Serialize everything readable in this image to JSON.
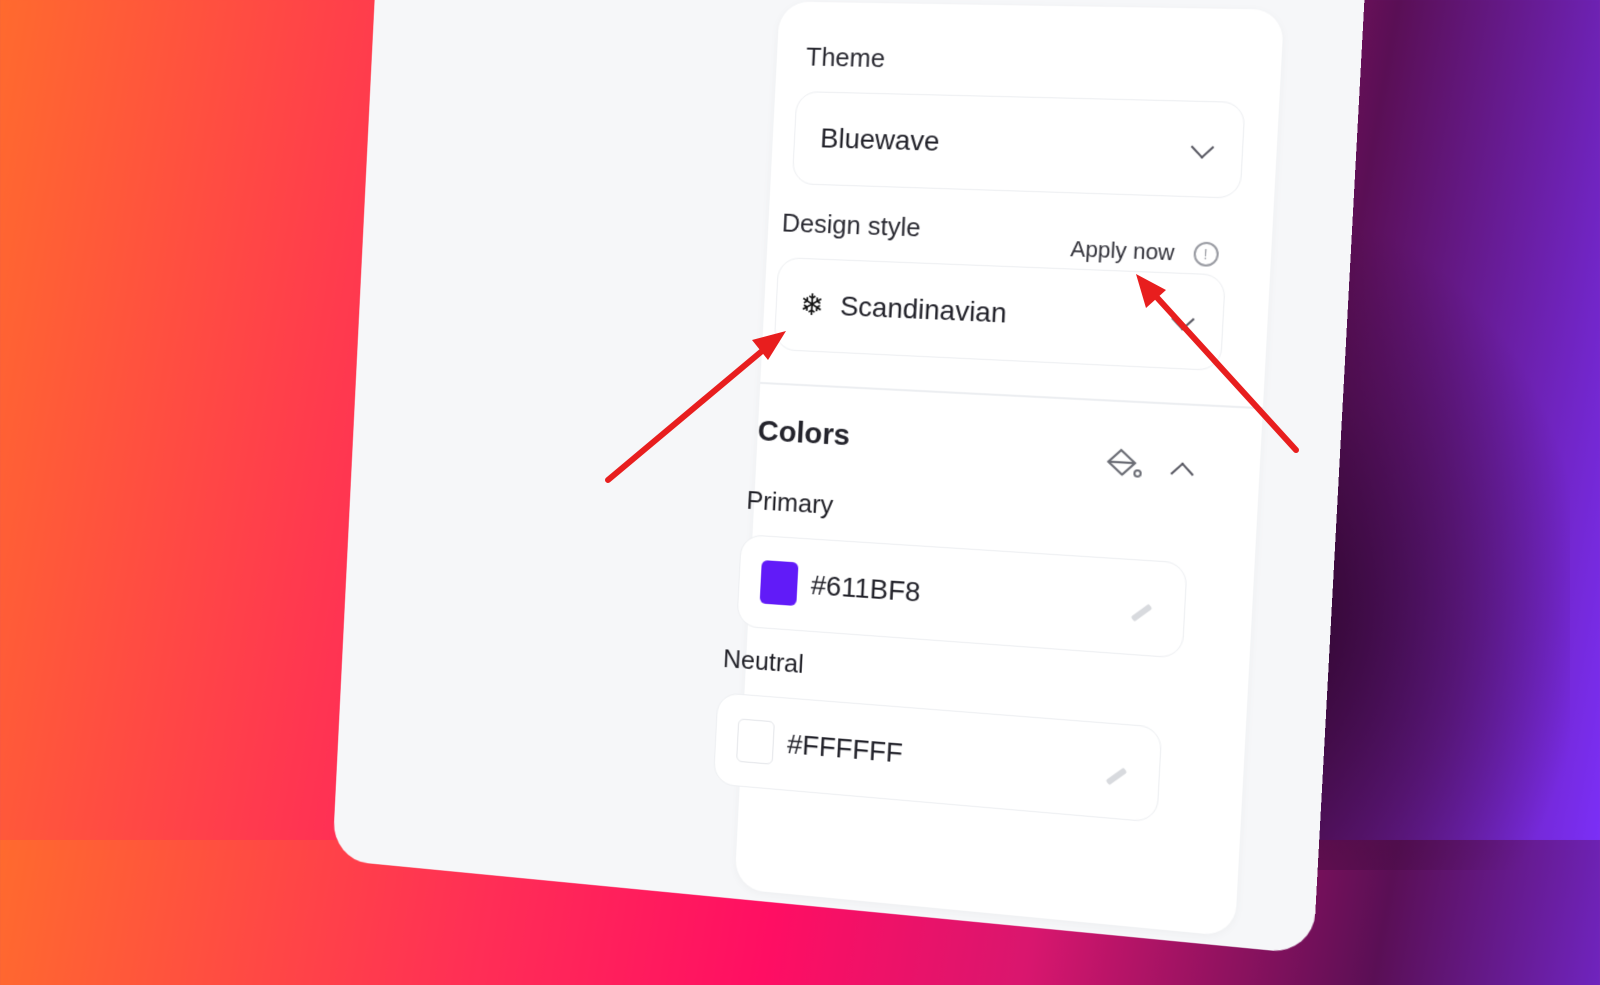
{
  "theme": {
    "label": "Theme",
    "value": "Bluewave"
  },
  "design_style": {
    "label": "Design style",
    "apply_label": "Apply now",
    "value": "Scandinavian",
    "icon": "snowflake-icon"
  },
  "colors": {
    "heading": "Colors",
    "primary": {
      "label": "Primary",
      "value": "#611BF8",
      "swatch": "#611BF8"
    },
    "neutral": {
      "label": "Neutral",
      "value": "#FFFFFF",
      "swatch": "#FFFFFF"
    }
  },
  "accent_colors": {
    "arrow": "#e81e1e"
  }
}
